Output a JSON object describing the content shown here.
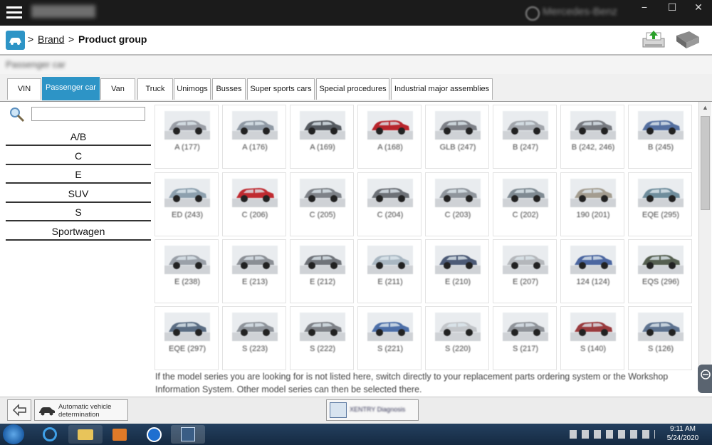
{
  "app": {
    "title": "Mercedes-Benz",
    "minimize": "−",
    "maximize": "☐",
    "close": "✕"
  },
  "breadcrumb": {
    "separator": ">",
    "brand": "Brand",
    "current": "Product group"
  },
  "subheader_text": "Passenger car",
  "tabs": [
    {
      "label": "VIN",
      "active": false
    },
    {
      "label": "Passenger car",
      "active": true
    },
    {
      "label": "Van",
      "active": false
    },
    {
      "label": "Truck",
      "active": false
    },
    {
      "label": "Unimogs",
      "active": false
    },
    {
      "label": "Busses",
      "active": false
    },
    {
      "label": "Super sports cars",
      "active": false
    },
    {
      "label": "Special procedures",
      "active": false
    },
    {
      "label": "Industrial major assemblies",
      "active": false
    }
  ],
  "search": {
    "value": "",
    "placeholder": ""
  },
  "categories": [
    "A/B",
    "C",
    "E",
    "SUV",
    "S",
    "Sportwagen"
  ],
  "models": [
    [
      "A (177)",
      "A (176)",
      "A (169)",
      "A (168)",
      "GLB (247)",
      "B (247)",
      "B (242, 246)",
      "B (245)"
    ],
    [
      "ED (243)",
      "C (206)",
      "C (205)",
      "C (204)",
      "C (203)",
      "C (202)",
      "190 (201)",
      "EQE (295)"
    ],
    [
      "E (238)",
      "E (213)",
      "E (212)",
      "E (211)",
      "E (210)",
      "E (207)",
      "124 (124)",
      "EQS (296)"
    ],
    [
      "EQE (297)",
      "S (223)",
      "S (222)",
      "S (221)",
      "S (220)",
      "S (217)",
      "S (140)",
      "S (126)"
    ]
  ],
  "car_colors": [
    [
      "#9a9ea6",
      "#8f99a4",
      "#555a60",
      "#b8252c",
      "#7d8087",
      "#a2a6ac",
      "#777a80",
      "#5570a0"
    ],
    [
      "#8da0ae",
      "#c02a30",
      "#7e8288",
      "#6d7177",
      "#8f959c",
      "#7f8a92",
      "#a49d90",
      "#6f8d9c"
    ],
    [
      "#9aa0a8",
      "#8a8e94",
      "#6f7379",
      "#a9b7c2",
      "#4c5a76",
      "#b4b7bb",
      "#4b66a0",
      "#555f50"
    ],
    [
      "#5b6d83",
      "#8e939a",
      "#7e8187",
      "#4d6fa8",
      "#c3c6ca",
      "#8f9399",
      "#9a3b3e",
      "#5e7390"
    ]
  ],
  "info_text": "If the model series you are looking for is not listed here, switch directly to your replacement parts ordering system or the Workshop Information System. Other model series can then be selected there.",
  "bottom": {
    "back_icon": "back-arrow-icon",
    "auto_vehicle_label": "Automatic vehicle determination",
    "center_button_label": "XENTRY Diagnosis"
  },
  "taskbar": {
    "time": "9:11 AM",
    "date": "5/24/2020"
  }
}
